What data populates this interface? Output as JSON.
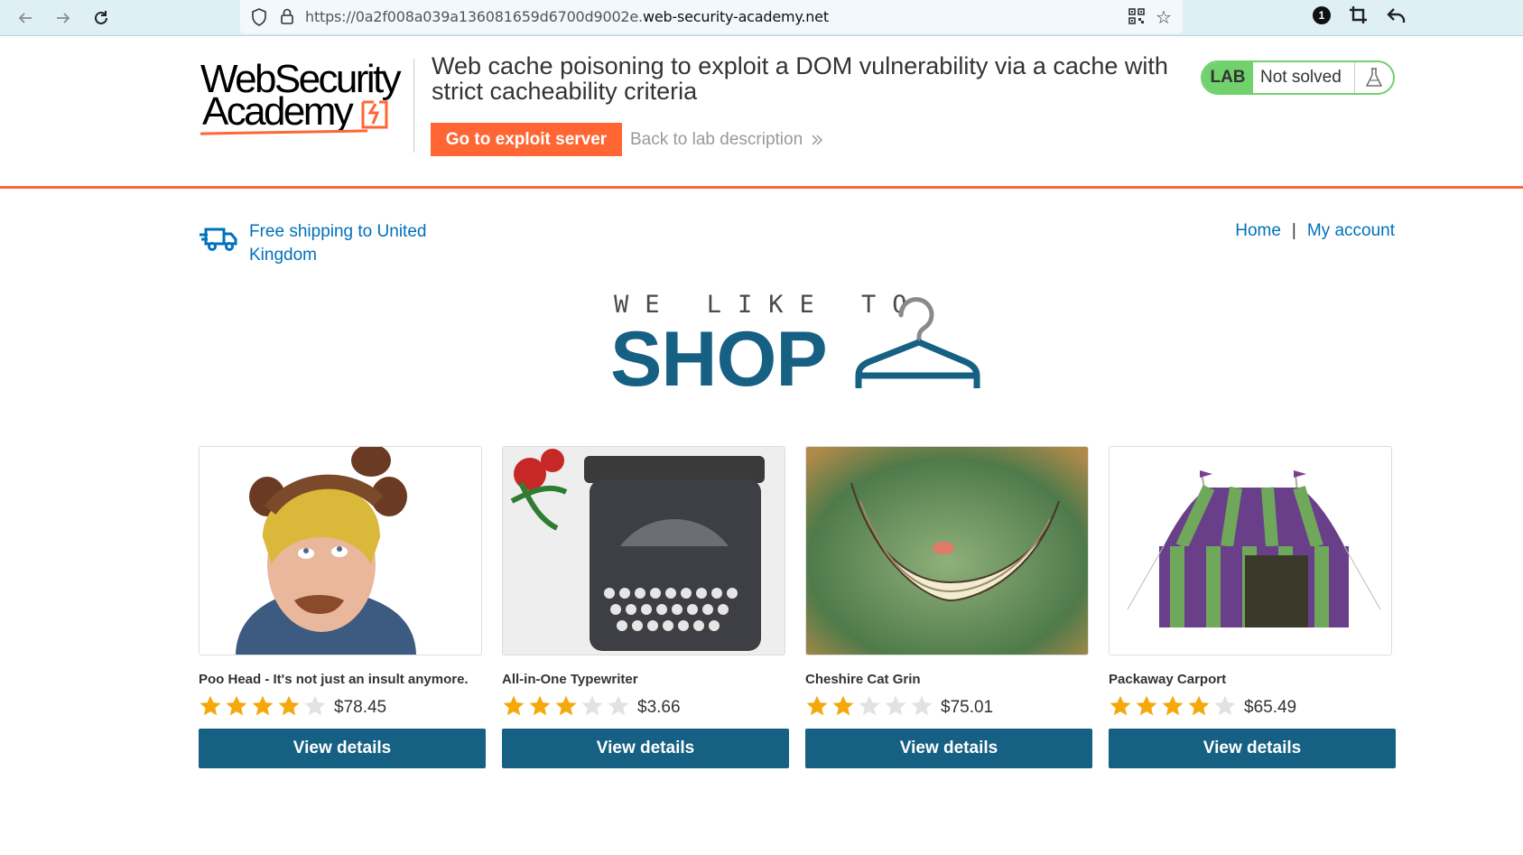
{
  "browser": {
    "url_prefix": "https://0a2f008a039a136081659d6700d9002e.",
    "url_host": "web-security-academy.net",
    "extension_badge": "1"
  },
  "lab_header": {
    "logo_line1": "WebSecurity",
    "logo_line2": "Academy",
    "title": "Web cache poisoning to exploit a DOM vulnerability via a cache with strict cacheability criteria",
    "exploit_button": "Go to exploit server",
    "back_link": "Back to lab description",
    "status_label": "LAB",
    "status_value": "Not solved"
  },
  "shop": {
    "shipping_text": "Free shipping to United Kingdom",
    "nav": {
      "home": "Home",
      "separator": "|",
      "account": "My account"
    },
    "hero_small": "WE LIKE TO",
    "hero_big": "SHOP"
  },
  "products": [
    {
      "name": "Poo Head - It's not just an insult anymore.",
      "rating": 4,
      "price": "$78.45",
      "button": "View details"
    },
    {
      "name": "All-in-One Typewriter",
      "rating": 3,
      "price": "$3.66",
      "button": "View details"
    },
    {
      "name": "Cheshire Cat Grin",
      "rating": 2,
      "price": "$75.01",
      "button": "View details"
    },
    {
      "name": "Packaway Carport",
      "rating": 4,
      "price": "$65.49",
      "button": "View details"
    }
  ],
  "colors": {
    "accent_orange": "#ff6633",
    "lab_green": "#70d16d",
    "shop_blue": "#166083",
    "link_blue": "#0071bc",
    "star_gold": "#f5a80a",
    "star_empty": "#e2e2e2"
  }
}
